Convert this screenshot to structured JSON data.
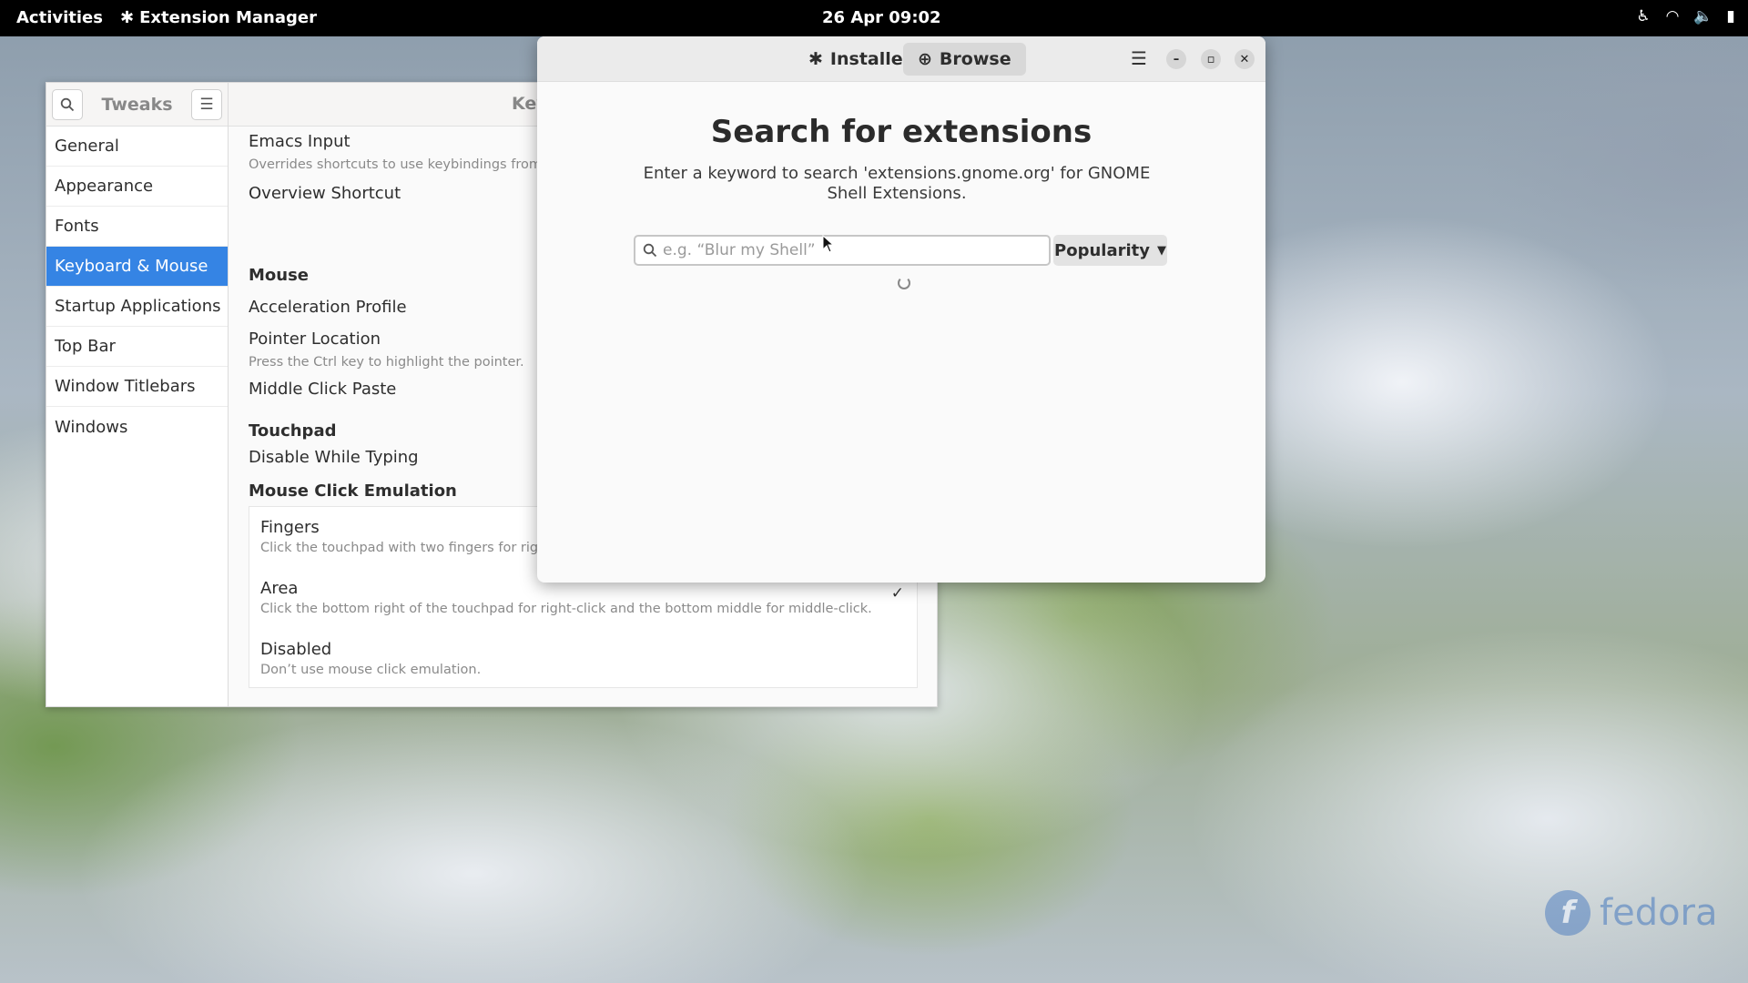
{
  "topbar": {
    "activities": "Activities",
    "app_name": "Extension Manager",
    "clock": "26 Apr  09:02"
  },
  "tweaks": {
    "title": "Tweaks",
    "main_title": "Key",
    "sidebar": [
      "General",
      "Appearance",
      "Fonts",
      "Keyboard & Mouse",
      "Startup Applications",
      "Top Bar",
      "Window Titlebars",
      "Windows"
    ],
    "active_item": "Keyboard & Mouse",
    "rows": {
      "emacs_input": "Emacs Input",
      "emacs_input_sub": "Overrides shortcuts to use keybindings from th",
      "overview_shortcut": "Overview Shortcut",
      "mouse_section": "Mouse",
      "acceleration_profile": "Acceleration Profile",
      "pointer_location": "Pointer Location",
      "pointer_location_sub": "Press the Ctrl key to highlight the pointer.",
      "middle_click_paste": "Middle Click Paste",
      "touchpad_section": "Touchpad",
      "disable_while_typing": "Disable While Typing",
      "mouse_click_emulation": "Mouse Click Emulation"
    },
    "emulation_options": [
      {
        "title": "Fingers",
        "sub": "Click the touchpad with two fingers for right"
      },
      {
        "title": "Area",
        "sub": "Click the bottom right of the touchpad for right-click and the bottom middle for middle-click."
      },
      {
        "title": "Disabled",
        "sub": "Don’t use mouse click emulation."
      }
    ]
  },
  "extmgr": {
    "tabs": {
      "installed": "Installed",
      "browse": "Browse"
    },
    "selected_tab": "Browse",
    "heading": "Search for extensions",
    "description": "Enter a keyword to search 'extensions.gnome.org' for GNOME Shell Extensions.",
    "search": {
      "placeholder": "e.g. “Blur my Shell”",
      "value": ""
    },
    "sort": {
      "selected": "Popularity"
    }
  },
  "branding": {
    "logo_text": "fedora"
  },
  "colors": {
    "accent": "#3584e4",
    "topbar": "#000000"
  }
}
